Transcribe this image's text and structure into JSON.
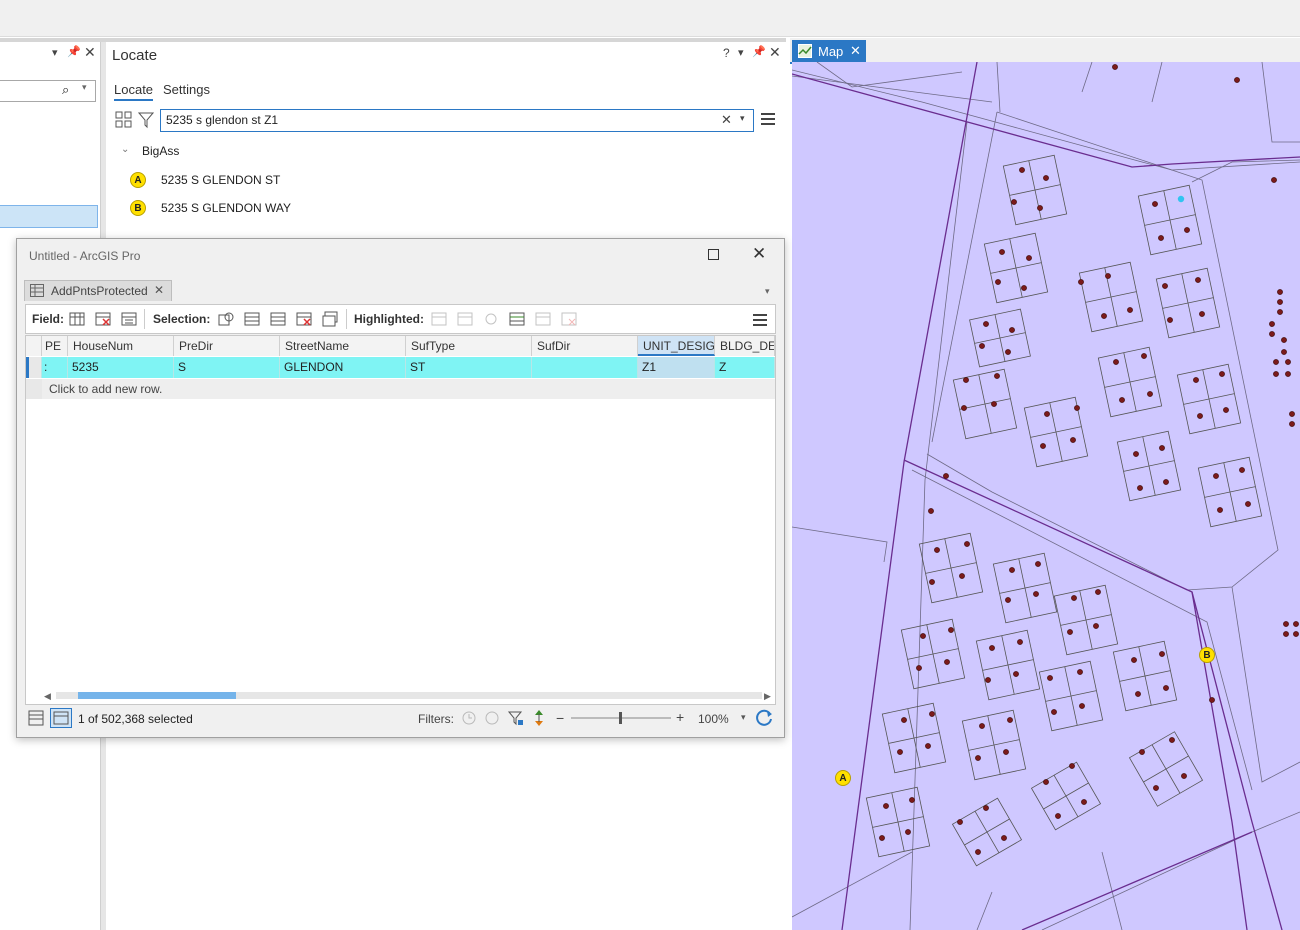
{
  "locate": {
    "title": "Locate",
    "tabs": [
      "Locate",
      "Settings"
    ],
    "search_value": "5235 s glendon st Z1",
    "group_label": "BigAss",
    "results": [
      {
        "marker": "A",
        "label": "5235 S GLENDON ST"
      },
      {
        "marker": "B",
        "label": "5235 S GLENDON WAY"
      }
    ],
    "help": "?"
  },
  "map": {
    "tab_label": "Map",
    "markers": [
      "A",
      "B"
    ],
    "colors": {
      "parcel_fill": "#cfc8ff",
      "point": "#7a1a1a",
      "selected_point": "#31c4f0",
      "boundary": "#6a2d8f"
    }
  },
  "table_window": {
    "title": "Untitled - ArcGIS Pro",
    "table_tab": "AddPntsProtected",
    "toolbar": {
      "field_label": "Field:",
      "selection_label": "Selection:",
      "highlighted_label": "Highlighted:"
    },
    "columns": [
      "PE",
      "HouseNum",
      "PreDir",
      "StreetName",
      "SufType",
      "SufDir",
      "UNIT_DESIG",
      "BLDG_DES"
    ],
    "rows": [
      [
        ":",
        "5235",
        "S",
        "GLENDON",
        "ST",
        "",
        "Z1",
        "Z"
      ]
    ],
    "add_row_text": "Click to add new row.",
    "status": {
      "selection_count": "1 of 502,368 selected",
      "filters_label": "Filters:",
      "zoom": "100%"
    }
  }
}
